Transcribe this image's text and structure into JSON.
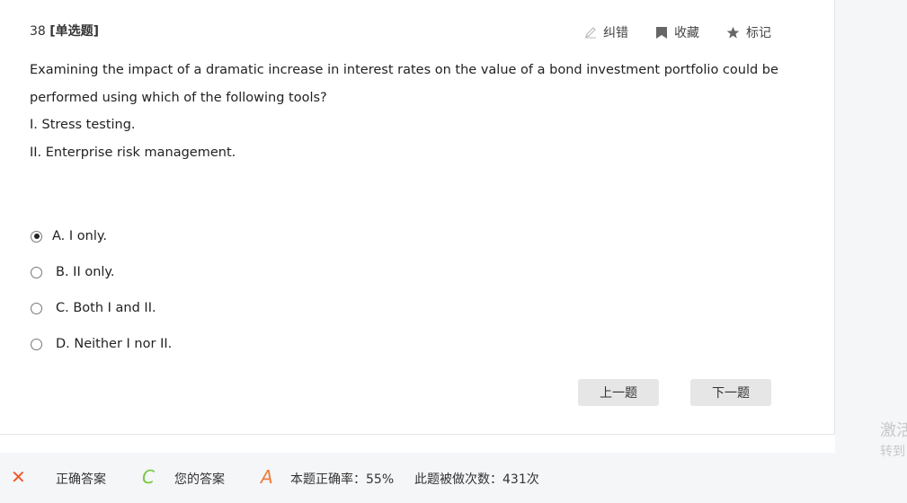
{
  "question": {
    "number": "38",
    "type_label": "[单选题]",
    "text_lines": [
      "Examining the impact of a dramatic increase in interest rates on the value of a bond investment portfolio could be performed using which of the following tools?",
      "I. Stress testing.",
      "II. Enterprise risk management."
    ]
  },
  "toolbar": {
    "report_error": "纠错",
    "favorite": "收藏",
    "mark": "标记"
  },
  "options": [
    {
      "label": "A. I only.",
      "selected": true
    },
    {
      "label": "B. II only.",
      "selected": false
    },
    {
      "label": "C. Both I and II.",
      "selected": false
    },
    {
      "label": "D. Neither I nor II.",
      "selected": false
    }
  ],
  "nav": {
    "prev": "上一题",
    "next": "下一题"
  },
  "result": {
    "correct_mark": "✕",
    "correct_label": "正确答案",
    "correct_answer": "C",
    "your_label": "您的答案",
    "your_answer": "A",
    "accuracy_text": "本题正确率：55%",
    "attempts_text": "此题被做次数：431次"
  },
  "watermark": {
    "line1": "激活",
    "line2": "转到"
  },
  "colors": {
    "wrong_mark": "#f05a28",
    "correct_answer": "#7ac943",
    "your_answer": "#f07a3a"
  }
}
